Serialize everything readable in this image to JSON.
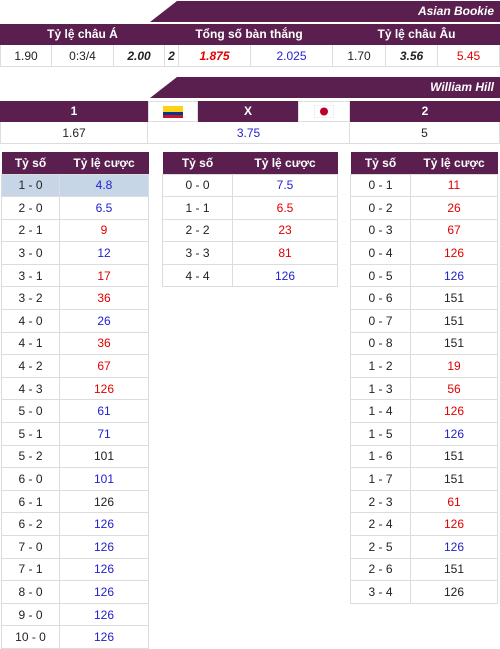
{
  "asian": {
    "bookie": "Asian Bookie",
    "headers": [
      "Tỷ lệ châu Á",
      "Tổng số bàn thắng",
      "Tỷ lệ châu Âu"
    ],
    "values": [
      {
        "text": "1.90",
        "style": "dark"
      },
      {
        "text": "0:3/4",
        "style": "dark"
      },
      {
        "text": "2.00",
        "style": "bold dark"
      },
      {
        "text": "2",
        "style": "bold dark"
      },
      {
        "text": "1.875",
        "style": "bold red"
      },
      {
        "text": "2.025",
        "style": "blue"
      },
      {
        "text": "1.70",
        "style": "dark"
      },
      {
        "text": "3.56",
        "style": "bold dark"
      },
      {
        "text": "5.45",
        "style": "red"
      }
    ]
  },
  "hill": {
    "bookie": "William Hill",
    "headers": {
      "home": "1",
      "draw": "X",
      "away": "2"
    },
    "values": {
      "home": "1.67",
      "draw": "3.75",
      "away": "5"
    },
    "flags": {
      "home": "colombia-flag",
      "away": "japan-flag"
    }
  },
  "tables": {
    "col_score": "Tỷ số",
    "col_odds": "Tỷ lệ cược",
    "home": [
      {
        "score": "1 - 0",
        "odds": "4.8",
        "color": "blue",
        "highlight": true
      },
      {
        "score": "2 - 0",
        "odds": "6.5",
        "color": "blue"
      },
      {
        "score": "2 - 1",
        "odds": "9",
        "color": "red"
      },
      {
        "score": "3 - 0",
        "odds": "12",
        "color": "blue"
      },
      {
        "score": "3 - 1",
        "odds": "17",
        "color": "red"
      },
      {
        "score": "3 - 2",
        "odds": "36",
        "color": "red"
      },
      {
        "score": "4 - 0",
        "odds": "26",
        "color": "blue"
      },
      {
        "score": "4 - 1",
        "odds": "36",
        "color": "red"
      },
      {
        "score": "4 - 2",
        "odds": "67",
        "color": "red"
      },
      {
        "score": "4 - 3",
        "odds": "126",
        "color": "red"
      },
      {
        "score": "5 - 0",
        "odds": "61",
        "color": "blue"
      },
      {
        "score": "5 - 1",
        "odds": "71",
        "color": "blue"
      },
      {
        "score": "5 - 2",
        "odds": "101",
        "color": "dark"
      },
      {
        "score": "6 - 0",
        "odds": "101",
        "color": "blue"
      },
      {
        "score": "6 - 1",
        "odds": "126",
        "color": "dark"
      },
      {
        "score": "6 - 2",
        "odds": "126",
        "color": "blue"
      },
      {
        "score": "7 - 0",
        "odds": "126",
        "color": "blue"
      },
      {
        "score": "7 - 1",
        "odds": "126",
        "color": "blue"
      },
      {
        "score": "8 - 0",
        "odds": "126",
        "color": "blue"
      },
      {
        "score": "9 - 0",
        "odds": "126",
        "color": "blue"
      },
      {
        "score": "10 - 0",
        "odds": "126",
        "color": "blue"
      }
    ],
    "draw": [
      {
        "score": "0 - 0",
        "odds": "7.5",
        "color": "blue"
      },
      {
        "score": "1 - 1",
        "odds": "6.5",
        "color": "red"
      },
      {
        "score": "2 - 2",
        "odds": "23",
        "color": "red"
      },
      {
        "score": "3 - 3",
        "odds": "81",
        "color": "red"
      },
      {
        "score": "4 - 4",
        "odds": "126",
        "color": "blue"
      }
    ],
    "away": [
      {
        "score": "0 - 1",
        "odds": "11",
        "color": "red"
      },
      {
        "score": "0 - 2",
        "odds": "26",
        "color": "red"
      },
      {
        "score": "0 - 3",
        "odds": "67",
        "color": "red"
      },
      {
        "score": "0 - 4",
        "odds": "126",
        "color": "red"
      },
      {
        "score": "0 - 5",
        "odds": "126",
        "color": "blue"
      },
      {
        "score": "0 - 6",
        "odds": "151",
        "color": "dark"
      },
      {
        "score": "0 - 7",
        "odds": "151",
        "color": "dark"
      },
      {
        "score": "0 - 8",
        "odds": "151",
        "color": "dark"
      },
      {
        "score": "1 - 2",
        "odds": "19",
        "color": "red"
      },
      {
        "score": "1 - 3",
        "odds": "56",
        "color": "red"
      },
      {
        "score": "1 - 4",
        "odds": "126",
        "color": "red"
      },
      {
        "score": "1 - 5",
        "odds": "126",
        "color": "blue"
      },
      {
        "score": "1 - 6",
        "odds": "151",
        "color": "dark"
      },
      {
        "score": "1 - 7",
        "odds": "151",
        "color": "dark"
      },
      {
        "score": "2 - 3",
        "odds": "61",
        "color": "red"
      },
      {
        "score": "2 - 4",
        "odds": "126",
        "color": "red"
      },
      {
        "score": "2 - 5",
        "odds": "126",
        "color": "blue"
      },
      {
        "score": "2 - 6",
        "odds": "151",
        "color": "dark"
      },
      {
        "score": "3 - 4",
        "odds": "126",
        "color": "dark"
      }
    ]
  },
  "colors": {
    "header_bg": "#5a1f4f",
    "red": "#e00000",
    "blue": "#2222cc",
    "highlight": "#c7d6e6"
  }
}
